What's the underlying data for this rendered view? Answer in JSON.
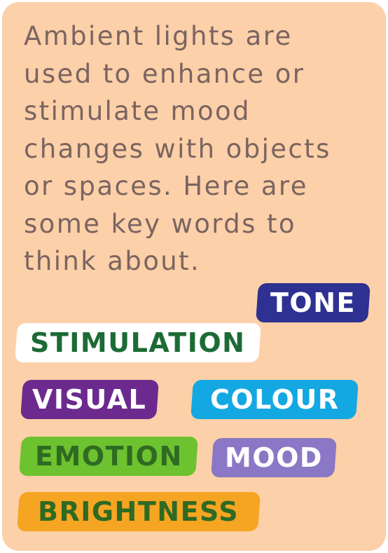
{
  "intro_text": "Ambient lights are used to enhance or stimulate mood changes with objects or spaces. Here are some key words to think about.",
  "keywords": [
    {
      "label": "TONE",
      "background": "#2e3192",
      "text_color": "#ffffff"
    },
    {
      "label": "STIMULATION",
      "background": "#ffffff",
      "text_color": "#1c6b35"
    },
    {
      "label": "VISUAL",
      "background": "#6c2a8f",
      "text_color": "#ffffff"
    },
    {
      "label": "COLOUR",
      "background": "#14a8e3",
      "text_color": "#ffffff"
    },
    {
      "label": "EMOTION",
      "background": "#6cc22f",
      "text_color": "#2f6a22"
    },
    {
      "label": "MOOD",
      "background": "#8a78c6",
      "text_color": "#ffffff"
    },
    {
      "label": "BRIGHTNESS",
      "background": "#f6a523",
      "text_color": "#2f6a22"
    }
  ],
  "colors": {
    "card_background": "#fcd0a8",
    "intro_text": "#7a6461"
  }
}
